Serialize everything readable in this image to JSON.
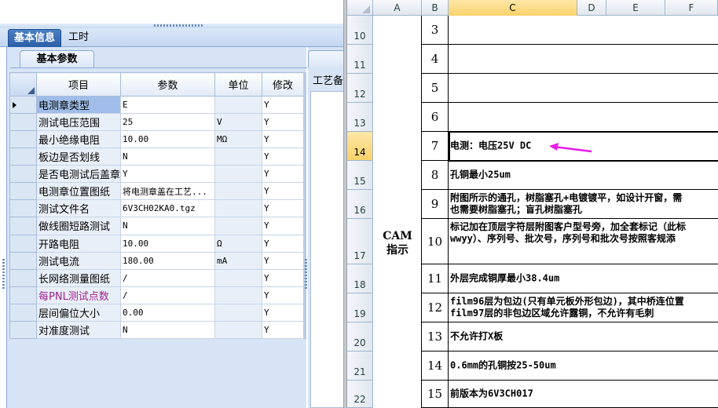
{
  "left_panel": {
    "tabs": [
      {
        "label": "基本信息",
        "active": true
      },
      {
        "label": "工时",
        "active": false
      }
    ],
    "subtab": "基本参数",
    "right_stub_label": "工艺备",
    "grid": {
      "columns": [
        "项目",
        "参数",
        "单位",
        "修改"
      ],
      "rows": [
        {
          "item": "电测章类型",
          "value": "E",
          "unit": "",
          "mod": "Y",
          "current": true
        },
        {
          "item": "测试电压范围",
          "value": "25",
          "unit": "V",
          "mod": "Y"
        },
        {
          "item": "最小绝缘电阻",
          "value": "10.00",
          "unit": "MΩ",
          "mod": "Y"
        },
        {
          "item": "板边是否划线",
          "value": "N",
          "unit": "",
          "mod": "Y"
        },
        {
          "item": "是否电测试后盖章",
          "value": "Y",
          "unit": "",
          "mod": "Y"
        },
        {
          "item": "电测章位置图纸",
          "value": "将电测章盖在工艺...",
          "unit": "",
          "mod": "Y"
        },
        {
          "item": "测试文件名",
          "value": "6V3CH02KA0.tgz",
          "unit": "",
          "mod": "Y"
        },
        {
          "item": "做线圈短路测试",
          "value": "N",
          "unit": "",
          "mod": "Y"
        },
        {
          "item": "开路电阻",
          "value": "10.00",
          "unit": "Ω",
          "mod": "Y"
        },
        {
          "item": "测试电流",
          "value": "180.00",
          "unit": "mA",
          "mod": "Y"
        },
        {
          "item": "长网络测量图纸",
          "value": "/",
          "unit": "",
          "mod": "Y"
        },
        {
          "item": "每PNL测试点数",
          "value": "/",
          "unit": "",
          "mod": "Y",
          "highlight": true
        },
        {
          "item": "层间偏位大小",
          "value": "0.00",
          "unit": "",
          "mod": "Y"
        },
        {
          "item": "对准度测试",
          "value": "N",
          "unit": "",
          "mod": "Y"
        }
      ]
    }
  },
  "excel": {
    "columns": [
      "A",
      "B",
      "C",
      "D",
      "E",
      "F"
    ],
    "row_headers": [
      "10",
      "11",
      "12",
      "13",
      "14",
      "15",
      "16",
      "17",
      "18",
      "19",
      "20",
      "21",
      "22"
    ],
    "section_label": [
      "CAM",
      "指示"
    ],
    "items": [
      {
        "num": "3",
        "lines": [
          ""
        ]
      },
      {
        "num": "4",
        "lines": [
          ""
        ]
      },
      {
        "num": "5",
        "lines": [
          ""
        ]
      },
      {
        "num": "6",
        "lines": [
          ""
        ]
      },
      {
        "num": "7",
        "lines": [
          "电测：电压25V DC"
        ]
      },
      {
        "num": "8",
        "lines": [
          "孔铜最小25um"
        ]
      },
      {
        "num": "9",
        "lines": [
          "附图所示的通孔，树脂塞孔+电镀镀平，如设计开窗，需",
          "也需要树脂塞孔；盲孔树脂塞孔"
        ]
      },
      {
        "num": "10",
        "lines": [
          "标记加在顶层字符层附图客户型号旁，加全套标记（此标",
          "wwyy）、序列号、批次号，序列号和批次号按照客规添"
        ]
      },
      {
        "num": "11",
        "lines": [
          "外层完成铜厚最小38.4um"
        ]
      },
      {
        "num": "12",
        "lines": [
          "film96层为包边(只有单元板外形包边)，其中桥连位置",
          "film97层的非包边区域允许露铜，不允许有毛刺"
        ]
      },
      {
        "num": "13",
        "lines": [
          "不允许打X板"
        ]
      },
      {
        "num": "14",
        "lines": [
          "0.6mm的孔铜按25-50um"
        ]
      },
      {
        "num": "15",
        "lines": [
          "前版本为6V3CH017"
        ]
      }
    ],
    "annotation_color": "#e61ee6"
  }
}
